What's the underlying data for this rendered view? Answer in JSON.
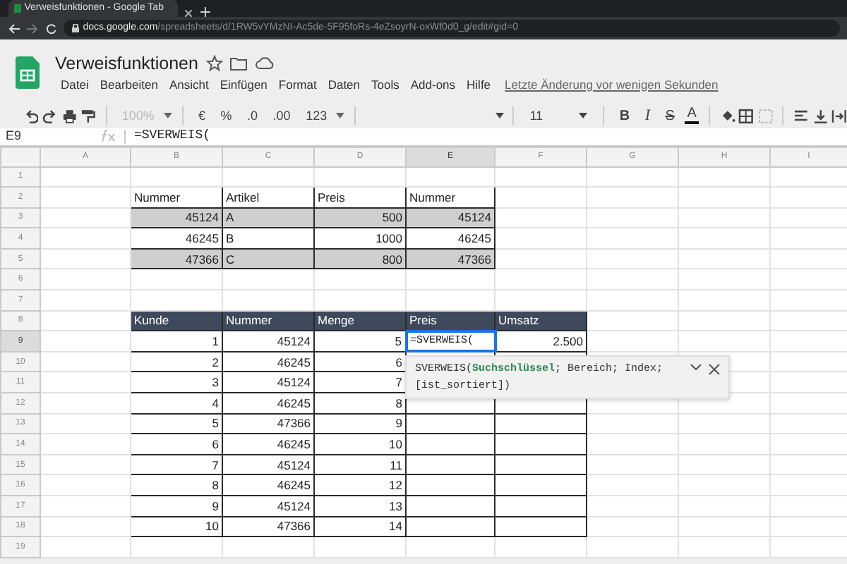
{
  "browser": {
    "tab_title": "Verweisfunktionen - Google Tab",
    "url_host": "docs.google.com",
    "url_path": "/spreadsheets/d/1RW5vYMzNI-Ac5de-5F95foRs-4eZsoyrN-oxWf0d0_g/edit#gid=0"
  },
  "document": {
    "title": "Verweisfunktionen",
    "menus": [
      "Datei",
      "Bearbeiten",
      "Ansicht",
      "Einfügen",
      "Format",
      "Daten",
      "Tools",
      "Add-ons",
      "Hilfe"
    ],
    "last_edit": "Letzte Änderung vor wenigen Sekunden"
  },
  "toolbar": {
    "zoom": {
      "value": "100%",
      "disabled": true
    },
    "currency": "€",
    "percent": "%",
    "decimal_less": ".0",
    "decimal_more": ".00",
    "number_format": "123",
    "font_size": "11",
    "bold": "B",
    "italic": "I",
    "strikethrough": "S",
    "text_color": "A"
  },
  "formula_bar": {
    "cell": "E9",
    "formula": "=SVERWEIS("
  },
  "columns": [
    {
      "label": "A",
      "selected": false
    },
    {
      "label": "B",
      "selected": false
    },
    {
      "label": "C",
      "selected": false
    },
    {
      "label": "D",
      "selected": false
    },
    {
      "label": "E",
      "selected": true
    },
    {
      "label": "F",
      "selected": false
    },
    {
      "label": "G",
      "selected": false
    },
    {
      "label": "H",
      "selected": false
    },
    {
      "label": "I",
      "selected": false
    }
  ],
  "rows": [
    {
      "number": "1",
      "selected": false
    },
    {
      "number": "2",
      "selected": false,
      "cells": [
        {
          "kind": "blank"
        },
        {
          "kind": "boxed",
          "text": "Nummer"
        },
        {
          "kind": "boxed",
          "text": "Artikel"
        },
        {
          "kind": "boxed",
          "text": "Preis"
        },
        {
          "kind": "boxed",
          "text": "Nummer"
        }
      ]
    },
    {
      "number": "3",
      "selected": false,
      "cells": [
        {
          "kind": "blank"
        },
        {
          "kind": "shaded",
          "text": "45124",
          "numeric": true
        },
        {
          "kind": "shaded",
          "text": "A"
        },
        {
          "kind": "shaded",
          "text": "500",
          "numeric": true
        },
        {
          "kind": "shaded",
          "text": "45124",
          "numeric": true
        }
      ]
    },
    {
      "number": "4",
      "selected": false,
      "cells": [
        {
          "kind": "blank"
        },
        {
          "kind": "boxed",
          "text": "46245",
          "numeric": true
        },
        {
          "kind": "boxed",
          "text": "B"
        },
        {
          "kind": "boxed",
          "text": "1000",
          "numeric": true
        },
        {
          "kind": "boxed",
          "text": "46245",
          "numeric": true
        }
      ]
    },
    {
      "number": "5",
      "selected": false,
      "cells": [
        {
          "kind": "blank"
        },
        {
          "kind": "shaded",
          "text": "47366",
          "numeric": true
        },
        {
          "kind": "shaded",
          "text": "C"
        },
        {
          "kind": "shaded",
          "text": "800",
          "numeric": true
        },
        {
          "kind": "shaded",
          "text": "47366",
          "numeric": true
        }
      ]
    },
    {
      "number": "6",
      "selected": false
    },
    {
      "number": "7",
      "selected": false
    },
    {
      "number": "8",
      "selected": false,
      "cells": [
        {
          "kind": "blank"
        },
        {
          "kind": "head",
          "text": "Kunde"
        },
        {
          "kind": "head",
          "text": "Nummer"
        },
        {
          "kind": "head",
          "text": "Menge"
        },
        {
          "kind": "head",
          "text": "Preis"
        },
        {
          "kind": "head",
          "text": "Umsatz"
        }
      ]
    },
    {
      "number": "9",
      "selected": true,
      "cells": [
        {
          "kind": "blank"
        },
        {
          "kind": "boxed",
          "text": "1",
          "numeric": true
        },
        {
          "kind": "boxed",
          "text": "45124",
          "numeric": true
        },
        {
          "kind": "boxed",
          "text": "5",
          "numeric": true
        },
        {
          "kind": "editing",
          "text": "=SVERWEIS("
        },
        {
          "kind": "boxed",
          "text": "2.500",
          "numeric": true
        }
      ]
    },
    {
      "number": "10",
      "selected": false,
      "cells": [
        {
          "kind": "blank"
        },
        {
          "kind": "boxed",
          "text": "2",
          "numeric": true
        },
        {
          "kind": "boxed",
          "text": "46245",
          "numeric": true
        },
        {
          "kind": "boxed",
          "text": "6",
          "numeric": true
        },
        {
          "kind": "boxed"
        },
        {
          "kind": "boxed"
        }
      ]
    },
    {
      "number": "11",
      "selected": false,
      "cells": [
        {
          "kind": "blank"
        },
        {
          "kind": "boxed",
          "text": "3",
          "numeric": true
        },
        {
          "kind": "boxed",
          "text": "45124",
          "numeric": true
        },
        {
          "kind": "boxed",
          "text": "7",
          "numeric": true
        },
        {
          "kind": "boxed"
        },
        {
          "kind": "boxed"
        }
      ]
    },
    {
      "number": "12",
      "selected": false,
      "cells": [
        {
          "kind": "blank"
        },
        {
          "kind": "boxed",
          "text": "4",
          "numeric": true
        },
        {
          "kind": "boxed",
          "text": "46245",
          "numeric": true
        },
        {
          "kind": "boxed",
          "text": "8",
          "numeric": true
        },
        {
          "kind": "boxed"
        },
        {
          "kind": "boxed"
        }
      ]
    },
    {
      "number": "13",
      "selected": false,
      "cells": [
        {
          "kind": "blank"
        },
        {
          "kind": "boxed",
          "text": "5",
          "numeric": true
        },
        {
          "kind": "boxed",
          "text": "47366",
          "numeric": true
        },
        {
          "kind": "boxed",
          "text": "9",
          "numeric": true
        },
        {
          "kind": "boxed"
        },
        {
          "kind": "boxed"
        }
      ]
    },
    {
      "number": "14",
      "selected": false,
      "cells": [
        {
          "kind": "blank"
        },
        {
          "kind": "boxed",
          "text": "6",
          "numeric": true
        },
        {
          "kind": "boxed",
          "text": "46245",
          "numeric": true
        },
        {
          "kind": "boxed",
          "text": "10",
          "numeric": true
        },
        {
          "kind": "boxed"
        },
        {
          "kind": "boxed"
        }
      ]
    },
    {
      "number": "15",
      "selected": false,
      "cells": [
        {
          "kind": "blank"
        },
        {
          "kind": "boxed",
          "text": "7",
          "numeric": true
        },
        {
          "kind": "boxed",
          "text": "45124",
          "numeric": true
        },
        {
          "kind": "boxed",
          "text": "11",
          "numeric": true
        },
        {
          "kind": "boxed"
        },
        {
          "kind": "boxed"
        }
      ]
    },
    {
      "number": "16",
      "selected": false,
      "cells": [
        {
          "kind": "blank"
        },
        {
          "kind": "boxed",
          "text": "8",
          "numeric": true
        },
        {
          "kind": "boxed",
          "text": "46245",
          "numeric": true
        },
        {
          "kind": "boxed",
          "text": "12",
          "numeric": true
        },
        {
          "kind": "boxed"
        },
        {
          "kind": "boxed"
        }
      ]
    },
    {
      "number": "17",
      "selected": false,
      "cells": [
        {
          "kind": "blank"
        },
        {
          "kind": "boxed",
          "text": "9",
          "numeric": true
        },
        {
          "kind": "boxed",
          "text": "45124",
          "numeric": true
        },
        {
          "kind": "boxed",
          "text": "13",
          "numeric": true
        },
        {
          "kind": "boxed"
        },
        {
          "kind": "boxed"
        }
      ]
    },
    {
      "number": "18",
      "selected": false,
      "cells": [
        {
          "kind": "blank"
        },
        {
          "kind": "boxed",
          "text": "10",
          "numeric": true
        },
        {
          "kind": "boxed",
          "text": "47366",
          "numeric": true
        },
        {
          "kind": "boxed",
          "text": "14",
          "numeric": true
        },
        {
          "kind": "boxed"
        },
        {
          "kind": "boxed"
        }
      ]
    },
    {
      "number": "19",
      "selected": false
    }
  ],
  "formula_hint": {
    "text": "SVERWEIS(**Suchschlüssel**; Bereich; Index; [ist_sortiert])"
  }
}
